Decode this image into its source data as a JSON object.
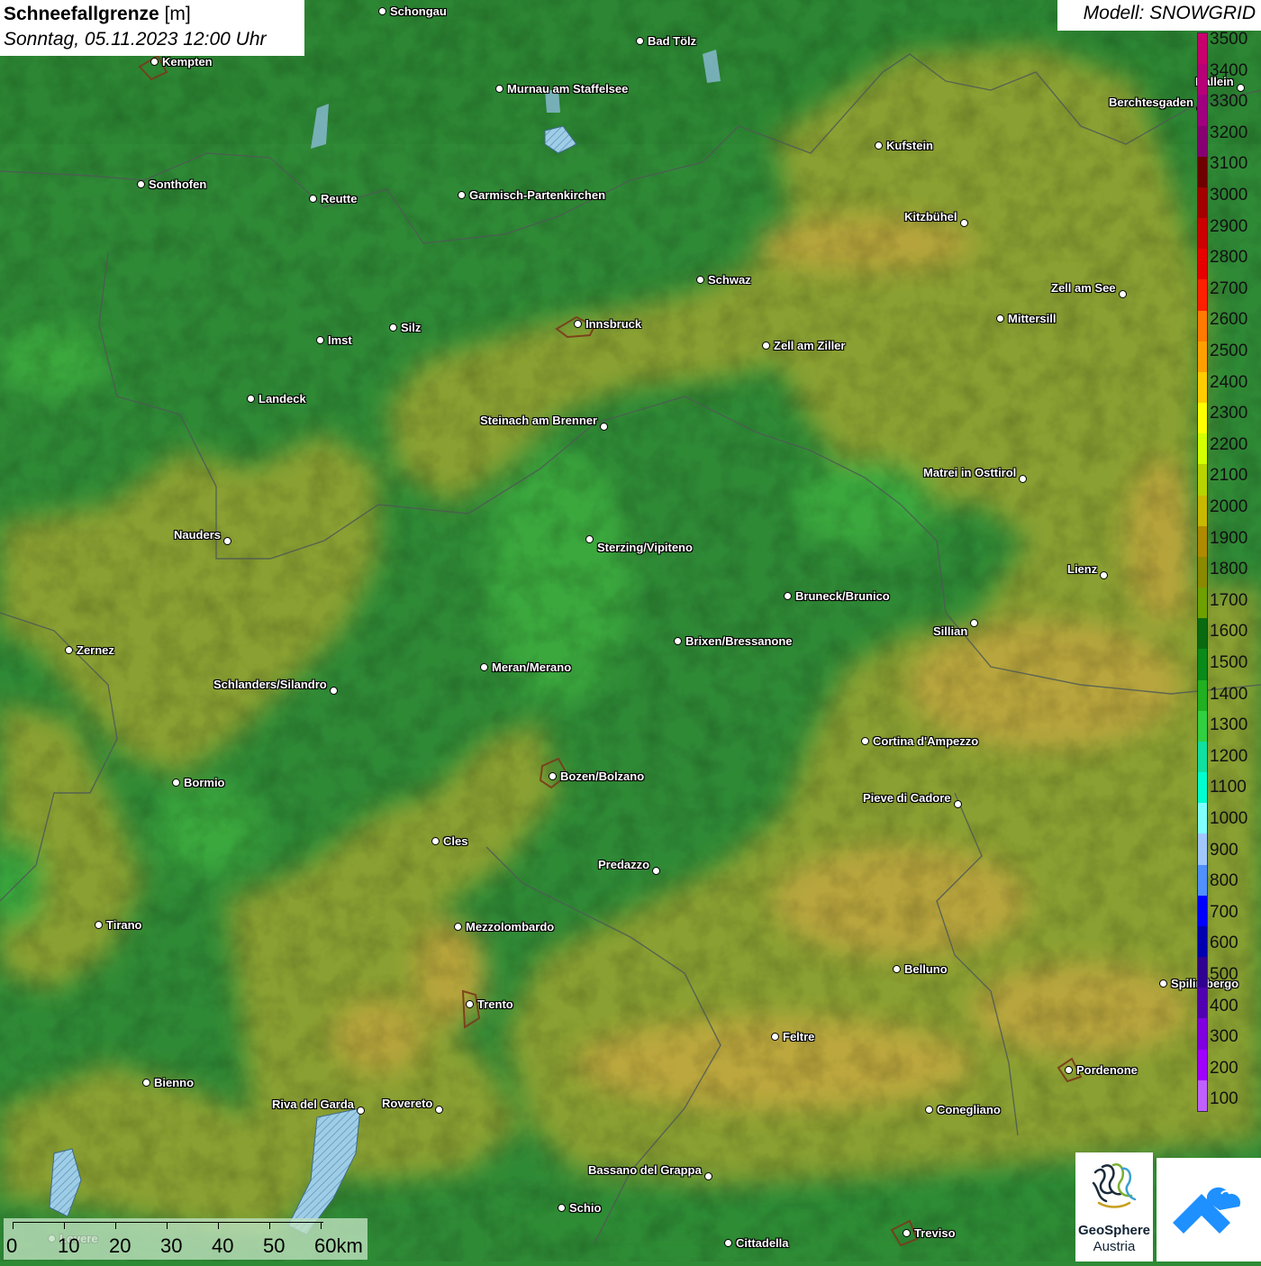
{
  "title": {
    "main_bold": "Schneefallgrenze",
    "unit": " [m]",
    "datetime": "Sonntag, 05.11.2023 12:00 Uhr"
  },
  "model_label": "Modell: SNOWGRID",
  "legend": {
    "labels": [
      "3500",
      "3400",
      "3300",
      "3200",
      "3100",
      "3000",
      "2900",
      "2800",
      "2700",
      "2600",
      "2500",
      "2400",
      "2300",
      "2200",
      "2100",
      "2000",
      "1900",
      "1800",
      "1700",
      "1600",
      "1500",
      "1400",
      "1300",
      "1200",
      "1100",
      "1000",
      "900",
      "800",
      "700",
      "600",
      "500",
      "400",
      "300",
      "200",
      "100"
    ],
    "colors": [
      "#c8006e",
      "#b70078",
      "#a00080",
      "#870072",
      "#6e0000",
      "#a30000",
      "#cc0000",
      "#e80000",
      "#ff2000",
      "#ff7a00",
      "#ffa000",
      "#ffcc00",
      "#ffff00",
      "#d4ff00",
      "#b8d400",
      "#c8b800",
      "#b08a00",
      "#8a8a00",
      "#6ea000",
      "#0a6a10",
      "#0a8a18",
      "#20b020",
      "#30d040",
      "#10e0a0",
      "#00ffd0",
      "#80ffff",
      "#a0c8ff",
      "#5090ff",
      "#0000ff",
      "#0000b0",
      "#300090",
      "#5000b0",
      "#8000e0",
      "#a000ff",
      "#c060ff"
    ]
  },
  "cities": [
    {
      "name": "Schongau"
    },
    {
      "name": "Bad Tölz"
    },
    {
      "name": "Kempten"
    },
    {
      "name": "Murnau am Staffelsee"
    },
    {
      "name": "Kufstein"
    },
    {
      "name": "Berchtesgaden"
    },
    {
      "name": "Hallein"
    },
    {
      "name": "Sonthofen"
    },
    {
      "name": "Reutte"
    },
    {
      "name": "Garmisch-Partenkirchen"
    },
    {
      "name": "Kitzbühel"
    },
    {
      "name": "Schwaz"
    },
    {
      "name": "Zell am See"
    },
    {
      "name": "Innsbruck"
    },
    {
      "name": "Mittersill"
    },
    {
      "name": "Silz"
    },
    {
      "name": "Imst"
    },
    {
      "name": "Zell am Ziller"
    },
    {
      "name": "Landeck"
    },
    {
      "name": "Steinach am Brenner"
    },
    {
      "name": "Matrei in Osttirol"
    },
    {
      "name": "Nauders"
    },
    {
      "name": "Sterzing/Vipiteno"
    },
    {
      "name": "Lienz"
    },
    {
      "name": "Bruneck/Brunico"
    },
    {
      "name": "Sillian"
    },
    {
      "name": "Zernez"
    },
    {
      "name": "Brixen/Bressanone"
    },
    {
      "name": "Meran/Merano"
    },
    {
      "name": "Schlanders/Silandro"
    },
    {
      "name": "Cortina d'Ampezzo"
    },
    {
      "name": "Bozen/Bolzano"
    },
    {
      "name": "Bormio"
    },
    {
      "name": "Pieve di Cadore"
    },
    {
      "name": "Cles"
    },
    {
      "name": "Predazzo"
    },
    {
      "name": "Tirano"
    },
    {
      "name": "Mezzolombardo"
    },
    {
      "name": "Belluno"
    },
    {
      "name": "Spilimbergo"
    },
    {
      "name": "Trento"
    },
    {
      "name": "Feltre"
    },
    {
      "name": "Pordenone"
    },
    {
      "name": "Bienno"
    },
    {
      "name": "Riva del Garda"
    },
    {
      "name": "Rovereto"
    },
    {
      "name": "Conegliano"
    },
    {
      "name": "Bassano del Grappa"
    },
    {
      "name": "Schio"
    },
    {
      "name": "Treviso"
    },
    {
      "name": "Cittadella"
    },
    {
      "name": "Lovere"
    }
  ],
  "scale_bar": {
    "labels": [
      "0",
      "10",
      "20",
      "30",
      "40",
      "50",
      "60km"
    ]
  },
  "logo": {
    "line1": "GeoSphere",
    "line2": "Austria"
  },
  "colors": {
    "low_green": "#2f8a36",
    "mid_olive": "#8a9a30",
    "high_yellow": "#b4a438",
    "bright_green": "#3cad3c"
  }
}
